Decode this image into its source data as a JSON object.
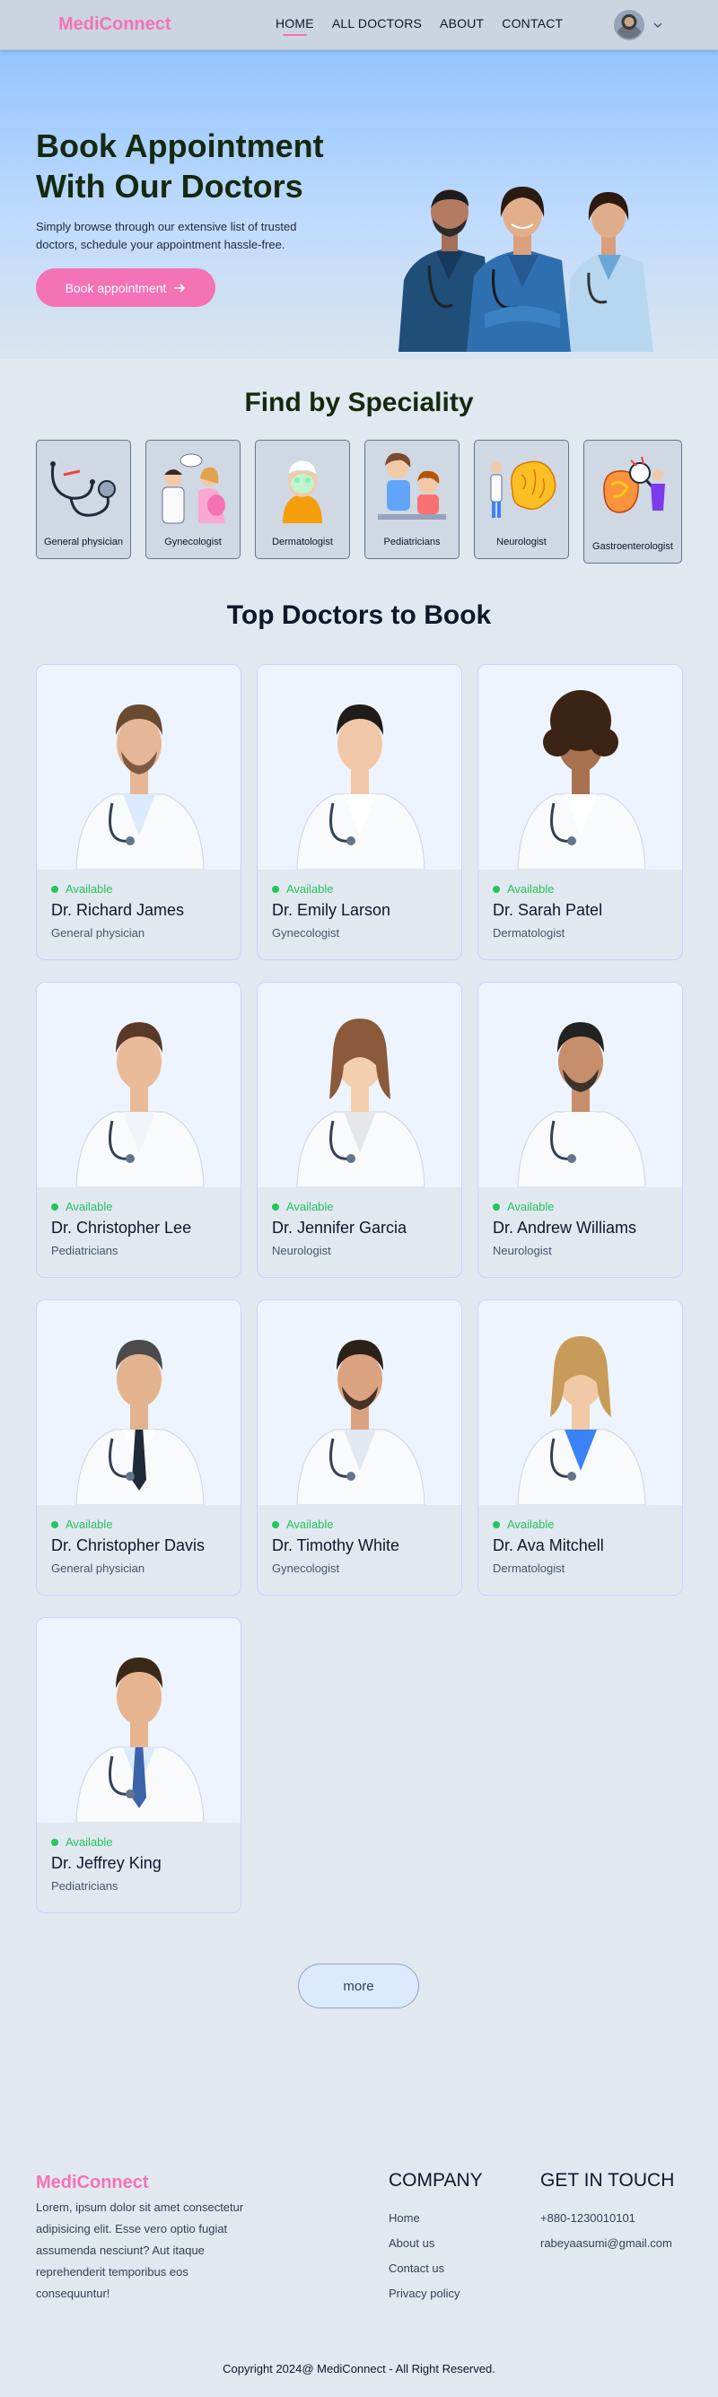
{
  "header": {
    "logo": "MediConnect",
    "nav": [
      "HOME",
      "ALL DOCTORS",
      "ABOUT",
      "CONTACT"
    ],
    "active_nav": "HOME"
  },
  "hero": {
    "title_line1": "Book Appointment",
    "title_line2": "With Our Doctors",
    "description": "Simply browse through our extensive list of trusted doctors, schedule your appointment hassle-free.",
    "cta_label": "Book appointment",
    "cta_icon": "arrow-right-icon"
  },
  "specialities": {
    "title": "Find by Speciality",
    "items": [
      {
        "label": "General physician",
        "icon": "stethoscope-icon"
      },
      {
        "label": "Gynecologist",
        "icon": "gynecologist-icon"
      },
      {
        "label": "Dermatologist",
        "icon": "dermatologist-icon"
      },
      {
        "label": "Pediatricians",
        "icon": "pediatrician-icon"
      },
      {
        "label": "Neurologist",
        "icon": "brain-icon"
      },
      {
        "label": "Gastroenterologist",
        "icon": "stomach-icon"
      }
    ]
  },
  "top_doctors": {
    "title": "Top Doctors to Book",
    "doctors": [
      {
        "name": "Dr. Richard James",
        "speciality": "General physician",
        "status": "Available"
      },
      {
        "name": "Dr. Emily Larson",
        "speciality": "Gynecologist",
        "status": "Available"
      },
      {
        "name": "Dr. Sarah Patel",
        "speciality": "Dermatologist",
        "status": "Available"
      },
      {
        "name": "Dr. Christopher Lee",
        "speciality": "Pediatricians",
        "status": "Available"
      },
      {
        "name": "Dr. Jennifer Garcia",
        "speciality": "Neurologist",
        "status": "Available"
      },
      {
        "name": "Dr. Andrew Williams",
        "speciality": "Neurologist",
        "status": "Available"
      },
      {
        "name": "Dr. Christopher Davis",
        "speciality": "General physician",
        "status": "Available"
      },
      {
        "name": "Dr. Timothy White",
        "speciality": "Gynecologist",
        "status": "Available"
      },
      {
        "name": "Dr. Ava Mitchell",
        "speciality": "Dermatologist",
        "status": "Available"
      },
      {
        "name": "Dr. Jeffrey King",
        "speciality": "Pediatricians",
        "status": "Available"
      }
    ],
    "more_label": "more"
  },
  "footer": {
    "logo": "MediConnect",
    "description": "Lorem, ipsum dolor sit amet consectetur adipisicing elit. Esse vero optio fugiat assumenda nesciunt? Aut itaque reprehenderit temporibus eos consequuntur!",
    "company_title": "COMPANY",
    "company_links": [
      "Home",
      "About us",
      "Contact us",
      "Privacy policy"
    ],
    "contact_title": "GET IN TOUCH",
    "phone": "+880-1230010101",
    "email": "rabeyaasumi@gmail.com",
    "copyright": "Copyright 2024@ MediConnect - All Right Reserved."
  },
  "colors": {
    "accent": "#f472b6",
    "available": "#22c55e",
    "hero_gradient_top": "#93c5fd",
    "page_bg": "#e2e8f0"
  }
}
